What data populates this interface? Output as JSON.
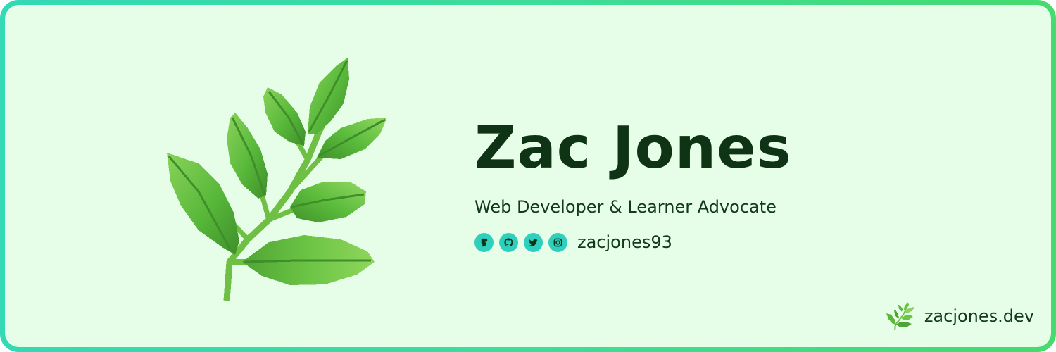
{
  "profile": {
    "name": "Zac Jones",
    "tagline": "Web Developer & Learner Advocate",
    "handle": "zacjones93",
    "website": "zacjones.dev"
  },
  "social_icons": [
    "egghead-icon",
    "github-icon",
    "twitter-icon",
    "instagram-icon"
  ],
  "colors": {
    "border_start": "#34d9b5",
    "border_end": "#45db6e",
    "background": "#e6fde8",
    "text_dark": "#0f3415",
    "icon_bg": "#2fcfbe",
    "leaf_dark": "#3e8f2a",
    "leaf_mid": "#58b83a",
    "leaf_light": "#8ad35a",
    "stem": "#6fbf45"
  }
}
